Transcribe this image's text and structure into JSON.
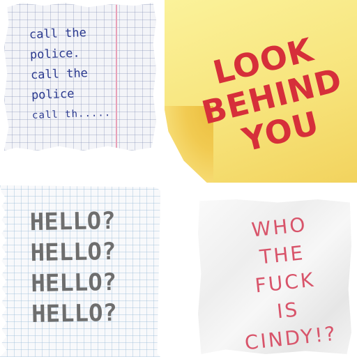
{
  "notes": [
    {
      "lines": [
        "call the",
        "police.",
        "call the",
        "police",
        "call th....."
      ]
    },
    {
      "lines": [
        "LOOK",
        "BEHIND",
        "YOU"
      ]
    },
    {
      "lines": [
        "HELLO?",
        "HELLO?",
        "HELLO?",
        "HELLO?"
      ]
    },
    {
      "lines": [
        "WHO",
        "THE",
        "FUCK",
        "IS",
        "CINDY!?"
      ]
    }
  ],
  "colors": {
    "note1_ink": "#2b3a8f",
    "note2_ink": "#d62f3a",
    "note2_paper": "#f7e47c",
    "note3_ink": "#6e6e6e",
    "note4_ink": "#d8546a"
  }
}
